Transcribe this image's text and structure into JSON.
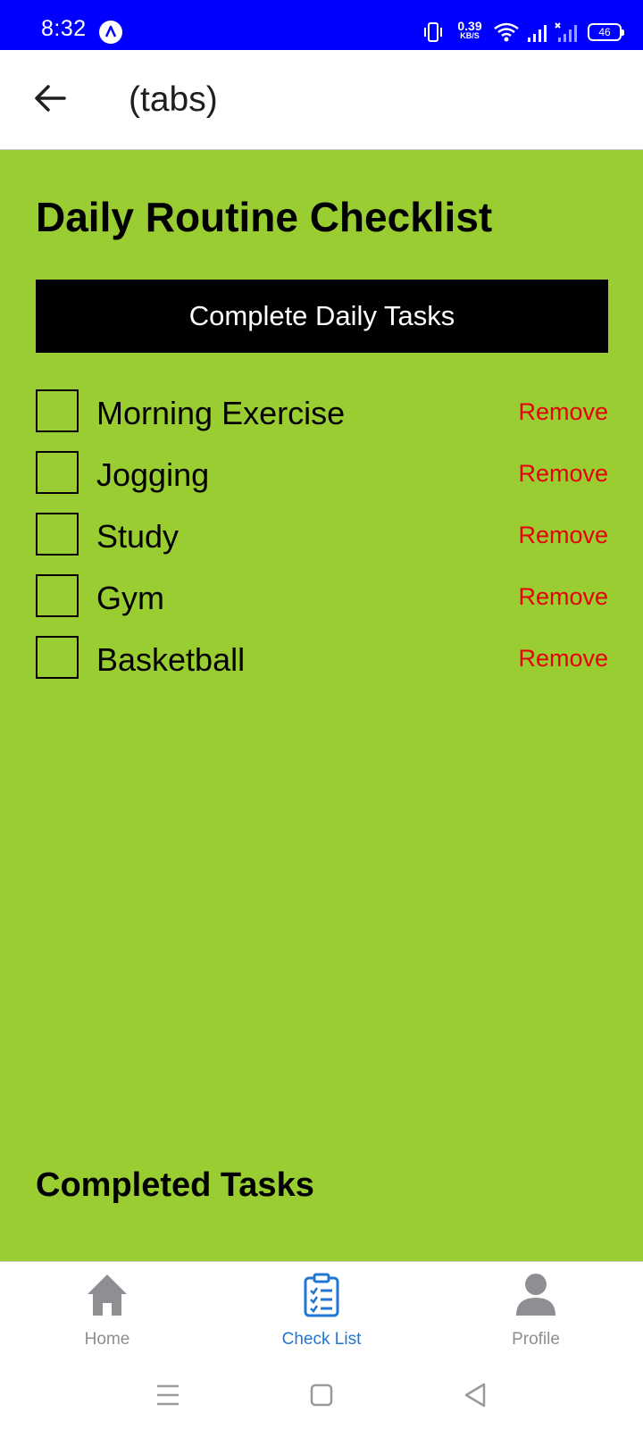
{
  "status_bar": {
    "time": "8:32",
    "net_speed_value": "0.39",
    "net_speed_unit": "KB/S",
    "battery": "46",
    "icons": [
      "app-notification-icon",
      "vibrate-icon",
      "wifi-icon",
      "signal-icon",
      "signal-no-service-icon",
      "battery-icon"
    ]
  },
  "header": {
    "back_icon": "arrow-left-icon",
    "title": "(tabs)"
  },
  "main": {
    "title": "Daily Routine Checklist",
    "complete_button_label": "Complete Daily Tasks",
    "tasks": [
      {
        "label": "Morning Exercise",
        "checked": false,
        "remove_label": "Remove"
      },
      {
        "label": "Jogging",
        "checked": false,
        "remove_label": "Remove"
      },
      {
        "label": "Study",
        "checked": false,
        "remove_label": "Remove"
      },
      {
        "label": "Gym",
        "checked": false,
        "remove_label": "Remove"
      },
      {
        "label": "Basketball",
        "checked": false,
        "remove_label": "Remove"
      }
    ],
    "completed_title": "Completed Tasks"
  },
  "bottom_nav": {
    "tabs": [
      {
        "label": "Home",
        "icon": "home-icon",
        "active": false
      },
      {
        "label": "Check List",
        "icon": "clipboard-checklist-icon",
        "active": true
      },
      {
        "label": "Profile",
        "icon": "person-icon",
        "active": false
      }
    ]
  },
  "system_nav": {
    "icons": [
      "menu-icon",
      "home-square-icon",
      "back-triangle-icon"
    ]
  },
  "colors": {
    "status_bar": "#0000ff",
    "content_background": "#9acd32",
    "remove": "#e8000b",
    "active_tab": "#1f77d3",
    "inactive_tab": "#8e8e93"
  }
}
